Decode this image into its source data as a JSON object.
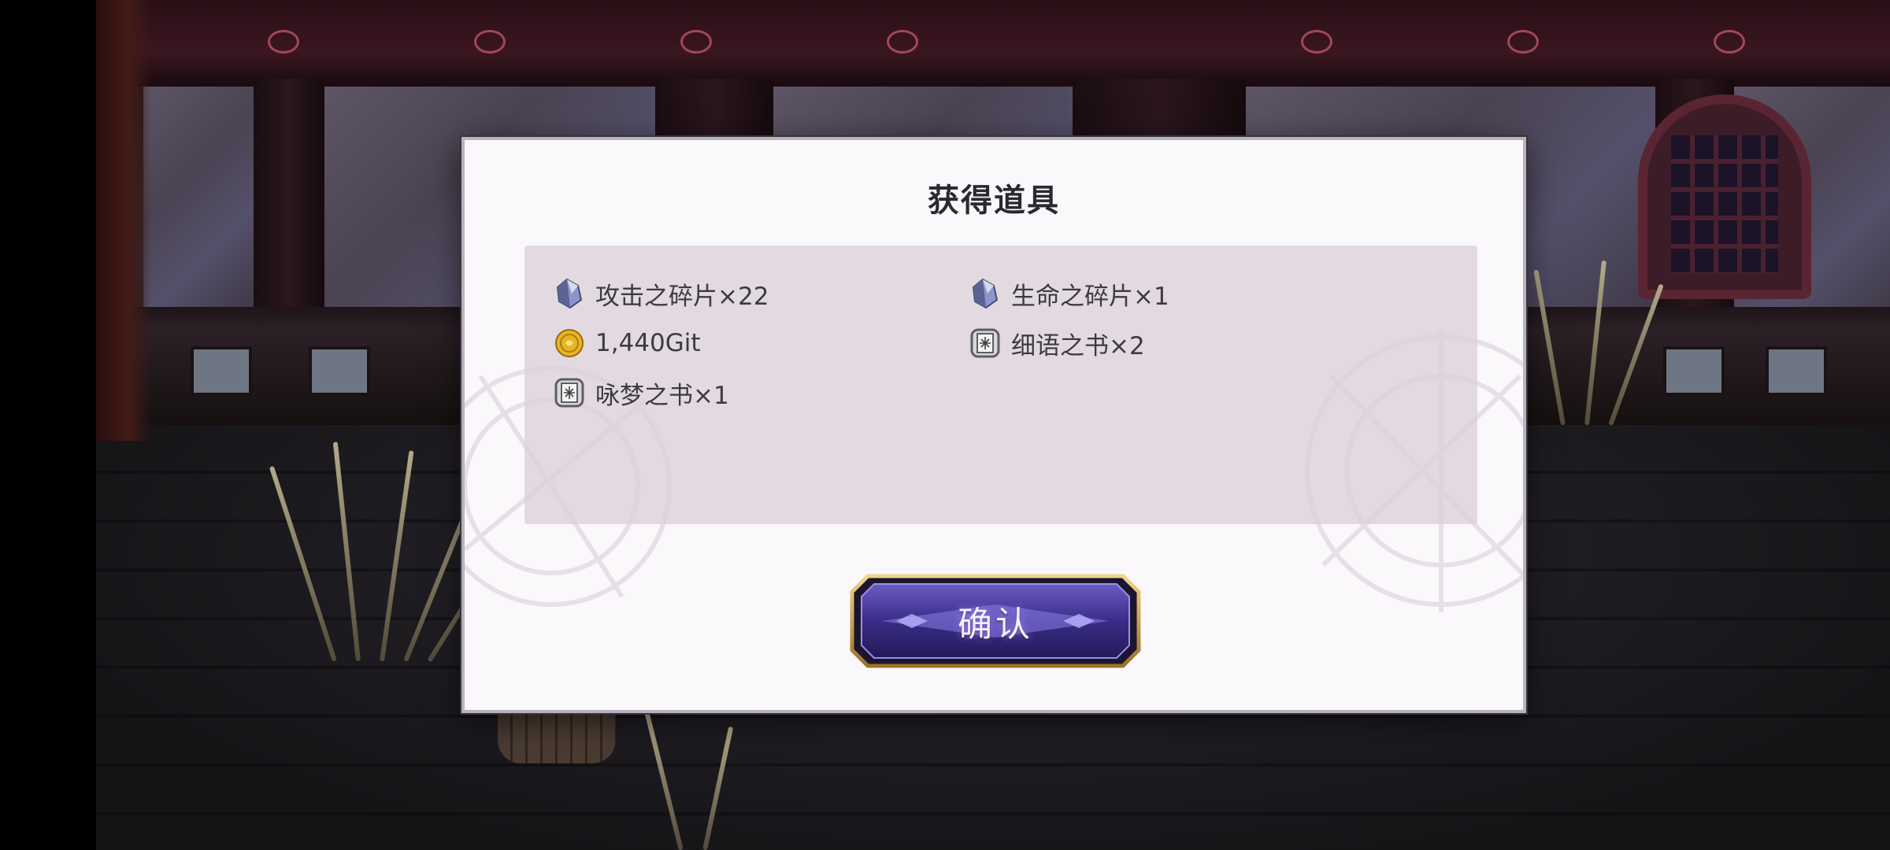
{
  "dialog": {
    "title": "获得道具",
    "items": [
      {
        "icon": "crystal-shard-icon",
        "label": "攻击之碎片×22"
      },
      {
        "icon": "crystal-shard-icon",
        "label": "生命之碎片×1"
      },
      {
        "icon": "gold-coin-icon",
        "label": "1,440Git"
      },
      {
        "icon": "book-icon",
        "label": "细语之书×2"
      },
      {
        "icon": "book-icon",
        "label": "咏梦之书×1"
      }
    ],
    "confirm_label": "确认"
  },
  "colors": {
    "dialog_bg": "#fbf8fb",
    "panel_bg": "#ddd0da",
    "button_primary": "#4a3a9a",
    "button_border": "#d9b45a"
  }
}
